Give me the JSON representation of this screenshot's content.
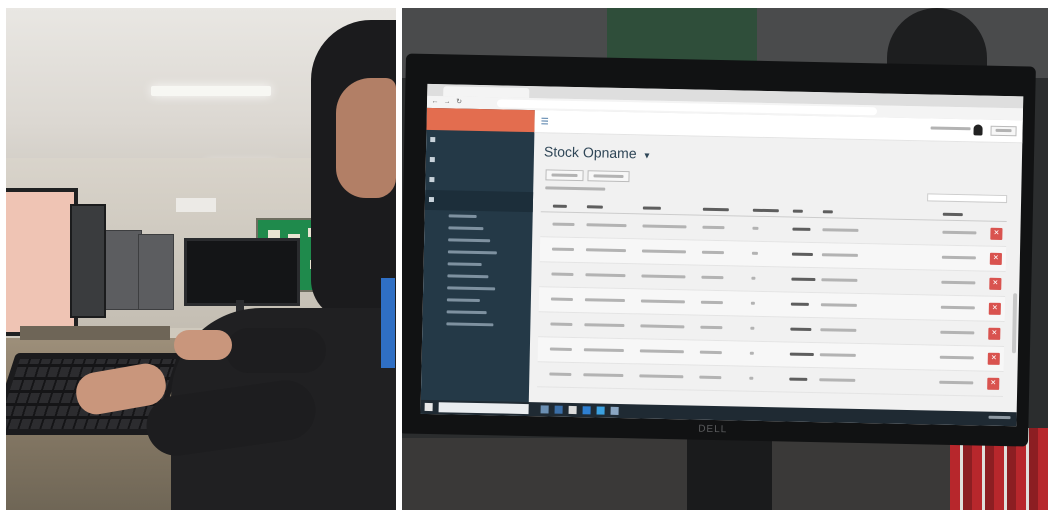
{
  "screen": {
    "browser": {
      "tab_title": "",
      "url": ""
    },
    "app": {
      "brand": "",
      "page_title": "Stock Opname",
      "dropdown_caret": "▾",
      "hamburger_glyph": "☰",
      "delete_glyph": "✕",
      "sidebar": [
        {
          "label": "",
          "icon": "dashboard-icon"
        },
        {
          "label": "",
          "icon": "list-icon"
        },
        {
          "label": "",
          "icon": "folder-icon"
        },
        {
          "label": "",
          "icon": "stack-icon"
        }
      ],
      "sidebar_submenu_count": 10,
      "table_rows": 7
    },
    "monitor_brand": "DELL"
  }
}
